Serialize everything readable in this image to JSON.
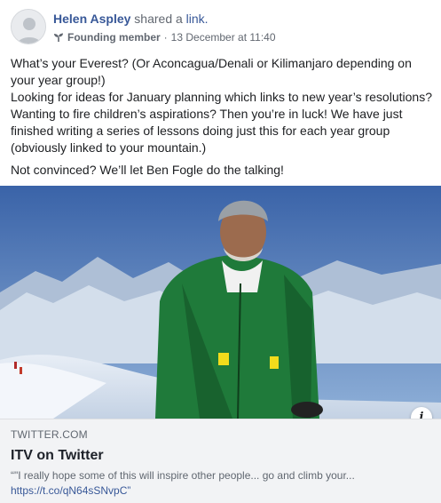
{
  "post": {
    "author": "Helen Aspley",
    "action_text": "shared a",
    "action_link": "link.",
    "badge_icon": "sprout-icon",
    "badge_label": "Founding member",
    "separator": "·",
    "timestamp": "13 December at 11:40",
    "paragraphs": [
      "What’s your Everest? (Or Aconcagua/Denali or Kilimanjaro depending on your year group!)",
      "Looking for ideas for January planning which links to new year’s resolutions? Wanting to fire children’s aspirations? Then you’re in luck! We have just finished writing a series of lessons doing just this for each year group (obviously linked to your mountain.)",
      "Not convinced? We’ll let Ben Fogle do the talking!"
    ]
  },
  "link_preview": {
    "domain": "TWITTER.COM",
    "title": "ITV on Twitter",
    "description": "“\"I really hope some of this will inspire other people... go and climb your...",
    "url": "https://t.co/qN64sSNvpC”",
    "info_label": "i",
    "info_icon": "info-icon"
  },
  "colors": {
    "link_blue": "#385898",
    "meta_gray": "#616770",
    "card_bg": "#f2f3f5",
    "jacket_green": "#1f7a3a"
  }
}
